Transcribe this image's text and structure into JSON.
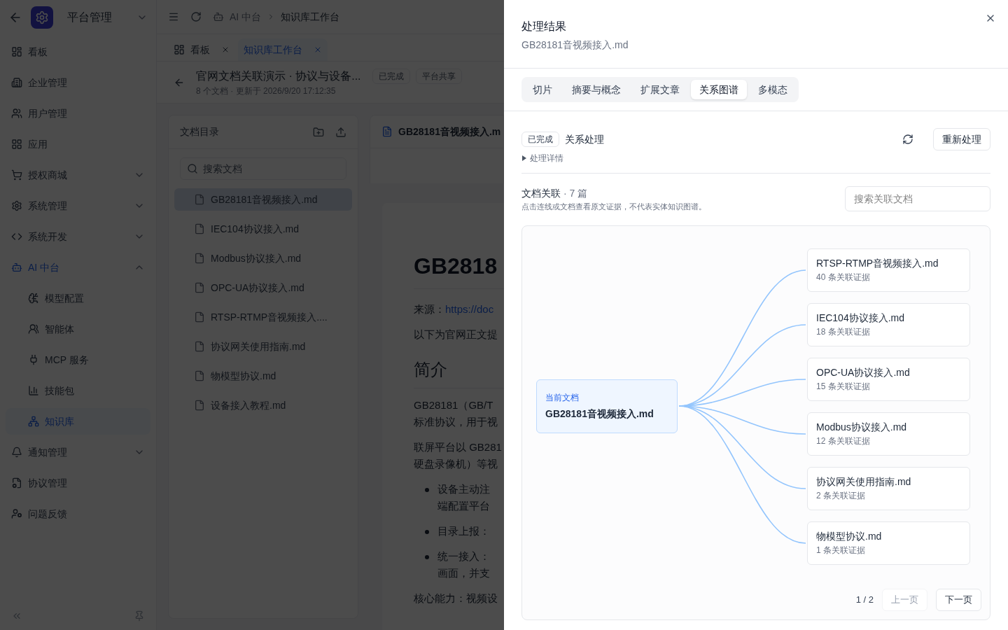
{
  "sidebar": {
    "title": "平台管理",
    "items": [
      {
        "kind": "link",
        "label": "看板",
        "selected": false
      },
      {
        "kind": "link",
        "label": "企业管理",
        "selected": false
      },
      {
        "kind": "link",
        "label": "用户管理",
        "selected": false
      },
      {
        "kind": "link",
        "label": "应用",
        "selected": false
      },
      {
        "kind": "group",
        "label": "授权商城",
        "expanded": false
      },
      {
        "kind": "group",
        "label": "系统管理",
        "expanded": false
      },
      {
        "kind": "group",
        "label": "系统开发",
        "expanded": false
      },
      {
        "kind": "group",
        "label": "AI 中台",
        "expanded": true,
        "children": [
          {
            "label": "模型配置",
            "selected": false
          },
          {
            "label": "智能体",
            "selected": false
          },
          {
            "label": "MCP 服务",
            "selected": false
          },
          {
            "label": "技能包",
            "selected": false
          },
          {
            "label": "知识库",
            "selected": true
          }
        ]
      },
      {
        "kind": "group",
        "label": "通知管理",
        "expanded": false
      },
      {
        "kind": "link",
        "label": "协议管理",
        "selected": false
      },
      {
        "kind": "link",
        "label": "问题反馈",
        "selected": false
      }
    ]
  },
  "breadcrumb": [
    "AI 中台",
    "知识库工作台"
  ],
  "tabs": [
    {
      "label": "看板",
      "selected": false
    },
    {
      "label": "知识库工作台",
      "selected": true
    }
  ],
  "page_header": {
    "title": "官网文档关联演示 · 协议与设备...",
    "meta": "8 个文档 · 更新于 2026/9/20 17:12:35",
    "tags": [
      "已完成",
      "平台共享"
    ]
  },
  "doc_panel": {
    "title": "文档目录",
    "search": {
      "placeholder": "搜索文档"
    },
    "files": [
      {
        "name": "GB28181音视频接入.md",
        "selected": true
      },
      {
        "name": "IEC104协议接入.md",
        "selected": false
      },
      {
        "name": "Modbus协议接入.md",
        "selected": false
      },
      {
        "name": "OPC-UA协议接入.md",
        "selected": false
      },
      {
        "name": "RTSP-RTMP音视频接入....",
        "selected": false
      },
      {
        "name": "协议网关使用指南.md",
        "selected": false
      },
      {
        "name": "物模型协议.md",
        "selected": false
      },
      {
        "name": "设备接入教程.md",
        "selected": false
      }
    ]
  },
  "preview": {
    "file": "GB28181音视频接入.m",
    "heading": "GB2818",
    "blocks": [
      {
        "kind": "source",
        "label": "来源：",
        "link": "https://doc"
      },
      {
        "kind": "para",
        "lines": [
          "以下为官网正文提"
        ]
      },
      {
        "kind": "h2",
        "lines": [
          "简介"
        ]
      },
      {
        "kind": "para",
        "lines": [
          "GB28181（GB/T",
          "标准协议，用于视"
        ]
      },
      {
        "kind": "para",
        "lines": [
          "联屏平台以 GB281",
          "硬盘录像机）等视"
        ]
      },
      {
        "kind": "bullet",
        "lines": [
          "设备主动注",
          "端配置平台"
        ]
      },
      {
        "kind": "bullet",
        "lines": [
          "目录上报："
        ]
      },
      {
        "kind": "bullet",
        "lines": [
          "统一接入：",
          "画面，并支"
        ]
      },
      {
        "kind": "para",
        "lines": [
          "核心能力：视频设"
        ]
      }
    ]
  },
  "drawer": {
    "title": "处理结果",
    "subtitle": "GB28181音视频接入.md",
    "tabs": [
      {
        "label": "切片",
        "selected": false
      },
      {
        "label": "摘要与概念",
        "selected": false
      },
      {
        "label": "扩展文章",
        "selected": false
      },
      {
        "label": "关系图谱",
        "selected": true
      },
      {
        "label": "多模态",
        "selected": false
      }
    ],
    "status": "已完成",
    "task": "关系处理",
    "reprocess": "重新处理",
    "details": {
      "label": "处理详情",
      "expanded": false
    },
    "relations": {
      "title": "文档关联",
      "count": "· 7 篇",
      "hint": "点击连线或文档查看原文证据，不代表实体知识图谱。",
      "search": {
        "placeholder": "搜索关联文档"
      },
      "center": {
        "label": "当前文档",
        "name": "GB28181音视频接入.md"
      },
      "related": [
        {
          "name": "RTSP-RTMP音视频接入.md",
          "evidence": "40 条关联证据"
        },
        {
          "name": "IEC104协议接入.md",
          "evidence": "18 条关联证据"
        },
        {
          "name": "OPC-UA协议接入.md",
          "evidence": "15 条关联证据"
        },
        {
          "name": "Modbus协议接入.md",
          "evidence": "12 条关联证据"
        },
        {
          "name": "协议网关使用指南.md",
          "evidence": "2 条关联证据"
        },
        {
          "name": "物模型协议.md",
          "evidence": "1 条关联证据"
        }
      ],
      "pagination": {
        "page": "1 / 2",
        "prev": {
          "label": "上一页",
          "disabled": true
        },
        "next": {
          "label": "下一页",
          "disabled": false
        }
      }
    }
  }
}
